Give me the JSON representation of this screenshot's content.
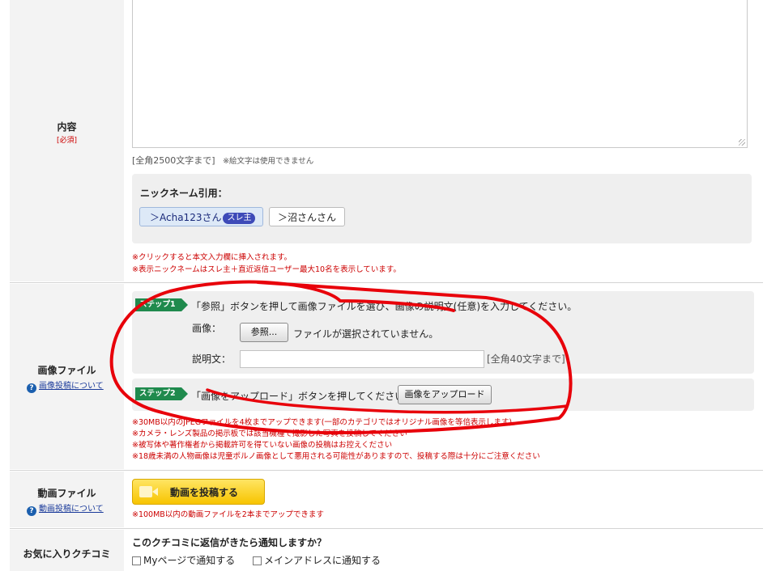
{
  "content": {
    "label": "内容",
    "required": "[必須]",
    "char_limit": "[全角2500文字まで]",
    "emoji_note": "※絵文字は使用できません"
  },
  "nickname": {
    "title": "ニックネーム引用：",
    "items": [
      {
        "label": "＞Acha123さん",
        "badge": "スレ主"
      },
      {
        "label": "＞沼さんさん"
      }
    ],
    "notes": [
      "※クリックすると本文入力欄に挿入されます。",
      "※表示ニックネームはスレ主＋直近返信ユーザー最大10名を表示しています。"
    ]
  },
  "image": {
    "label": "画像ファイル",
    "help_link": "画像投稿について",
    "step1_badge": "ステップ1",
    "step1_text": "「参照」ボタンを押して画像ファイルを選び、画像の説明文(任意)を入力してください。",
    "image_label": "画像：",
    "browse_button": "参照...",
    "no_file_text": "ファイルが選択されていません。",
    "desc_label": "説明文：",
    "desc_value": "",
    "desc_limit": "[全角40文字まで]",
    "step2_badge": "ステップ2",
    "step2_text": "「画像をアップロード」ボタンを押してください。",
    "upload_button": "画像をアップロード",
    "notes": [
      "※30MB以内のJPEGファイルを4枚までアップできます(一部のカテゴリではオリジナル画像を等倍表示します)",
      "※カメラ・レンズ製品の掲示板では該当機種で撮影した写真を投稿してください",
      "※被写体や著作権者から掲載許可を得ていない画像の投稿はお控えください",
      "※18歳未満の人物画像は児童ポルノ画像として悪用される可能性がありますので、投稿する際は十分にご注意ください"
    ]
  },
  "video": {
    "label": "動画ファイル",
    "help_link": "動画投稿について",
    "button": "動画を投稿する",
    "note": "※100MB以内の動画ファイルを2本までアップできます"
  },
  "favorite": {
    "label": "お気に入りクチコミ",
    "question": "このクチコミに返信がきたら通知しますか？",
    "option1": "Myページで通知する",
    "option2": "メインアドレスに通知する"
  },
  "annotation": {
    "color": "#e8000a",
    "shape": "hand-drawn-circle"
  },
  "colors": {
    "step_green": "#1f8a4d",
    "required_red": "#cc0000",
    "link_blue": "#1a3a9a",
    "video_yellow": "#f7c400"
  }
}
